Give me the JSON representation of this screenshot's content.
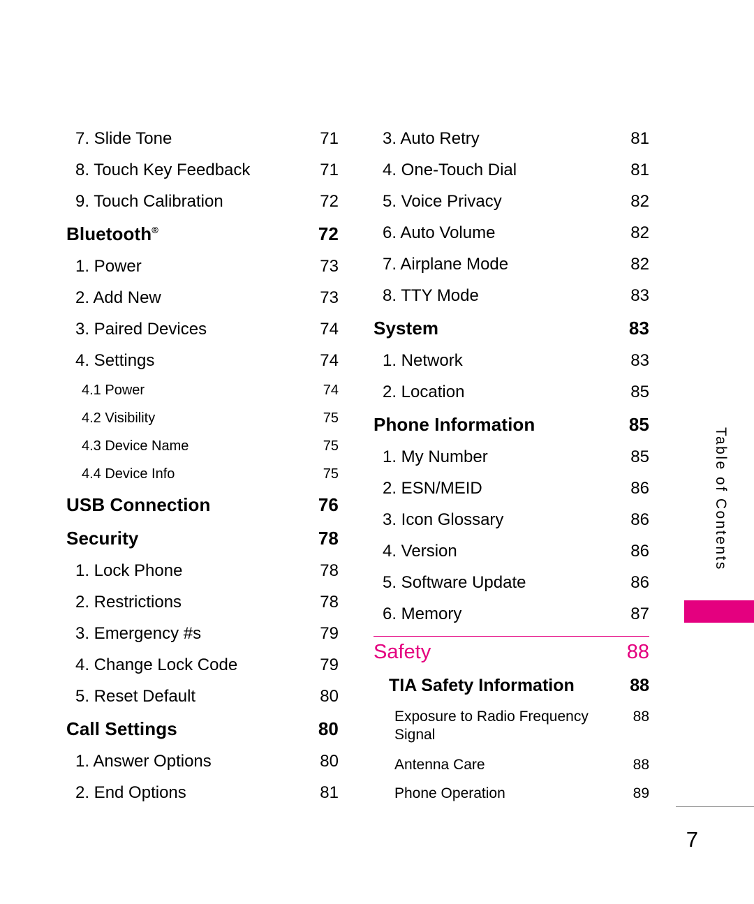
{
  "document": {
    "page_number": "7",
    "side_tab_text": "Table of Contents",
    "accent_color": "#E4007F"
  },
  "left_column": [
    {
      "label": "7. Slide Tone",
      "page": "71",
      "level": "sub"
    },
    {
      "label": "8. Touch Key Feedback",
      "page": "71",
      "level": "sub"
    },
    {
      "label": "9. Touch Calibration",
      "page": "72",
      "level": "sub"
    },
    {
      "label": "Bluetooth",
      "sup": "®",
      "page": "72",
      "level": "section"
    },
    {
      "label": "1. Power",
      "page": "73",
      "level": "sub"
    },
    {
      "label": "2. Add New",
      "page": "73",
      "level": "sub"
    },
    {
      "label": "3. Paired Devices",
      "page": "74",
      "level": "sub"
    },
    {
      "label": "4. Settings",
      "page": "74",
      "level": "sub"
    },
    {
      "label": "4.1 Power",
      "page": "74",
      "level": "subsub"
    },
    {
      "label": "4.2 Visibility",
      "page": "75",
      "level": "subsub"
    },
    {
      "label": "4.3 Device Name",
      "page": "75",
      "level": "subsub"
    },
    {
      "label": "4.4 Device Info",
      "page": "75",
      "level": "subsub"
    },
    {
      "label": "USB Connection",
      "page": "76",
      "level": "section"
    },
    {
      "label": "Security",
      "page": "78",
      "level": "section"
    },
    {
      "label": "1. Lock Phone",
      "page": "78",
      "level": "sub"
    },
    {
      "label": "2. Restrictions",
      "page": "78",
      "level": "sub"
    },
    {
      "label": "3. Emergency #s",
      "page": "79",
      "level": "sub"
    },
    {
      "label": "4. Change Lock Code",
      "page": "79",
      "level": "sub"
    },
    {
      "label": "5. Reset Default",
      "page": "80",
      "level": "sub"
    },
    {
      "label": "Call Settings",
      "page": "80",
      "level": "section"
    },
    {
      "label": "1. Answer Options",
      "page": "80",
      "level": "sub"
    },
    {
      "label": "2. End Options",
      "page": "81",
      "level": "sub"
    }
  ],
  "right_column": [
    {
      "label": "3. Auto Retry",
      "page": "81",
      "level": "sub"
    },
    {
      "label": "4. One-Touch Dial",
      "page": "81",
      "level": "sub"
    },
    {
      "label": "5. Voice Privacy",
      "page": "82",
      "level": "sub"
    },
    {
      "label": "6. Auto Volume",
      "page": "82",
      "level": "sub"
    },
    {
      "label": "7. Airplane Mode",
      "page": "82",
      "level": "sub"
    },
    {
      "label": "8. TTY Mode",
      "page": "83",
      "level": "sub"
    },
    {
      "label": "System",
      "page": "83",
      "level": "section"
    },
    {
      "label": "1. Network",
      "page": "83",
      "level": "sub"
    },
    {
      "label": "2. Location",
      "page": "85",
      "level": "sub"
    },
    {
      "label": "Phone Information",
      "page": "85",
      "level": "section"
    },
    {
      "label": "1. My Number",
      "page": "85",
      "level": "sub"
    },
    {
      "label": "2. ESN/MEID",
      "page": "86",
      "level": "sub"
    },
    {
      "label": "3. Icon Glossary",
      "page": "86",
      "level": "sub"
    },
    {
      "label": "4. Version",
      "page": "86",
      "level": "sub"
    },
    {
      "label": "5. Software Update",
      "page": "86",
      "level": "sub"
    },
    {
      "label": "6. Memory",
      "page": "87",
      "level": "sub"
    },
    {
      "label": "Safety",
      "page": "88",
      "level": "chapter",
      "rule_above": true
    },
    {
      "label": "TIA Safety Information",
      "page": "88",
      "level": "majorsub"
    },
    {
      "label": "Exposure to Radio Frequency Signal",
      "page": "88",
      "level": "sub2",
      "wrap": true
    },
    {
      "label": "Antenna Care",
      "page": "88",
      "level": "sub2"
    },
    {
      "label": "Phone Operation",
      "page": "89",
      "level": "sub2"
    }
  ]
}
